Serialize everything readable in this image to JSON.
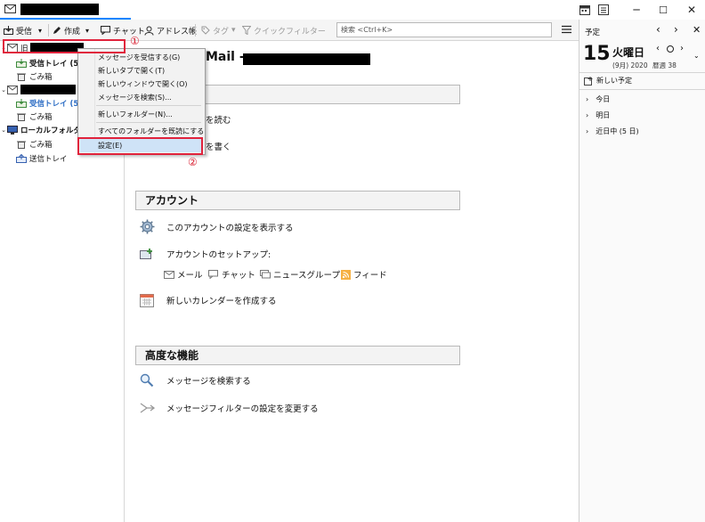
{
  "window": {
    "controls": {
      "minimize": "─",
      "maximize": "☐",
      "close": "✕"
    },
    "colors": {
      "accent": "#0a84ff",
      "highlight_red": "#e0233c",
      "selected_blue": "#2b6cc4"
    }
  },
  "toolbar": {
    "get_mail": "受信",
    "write": "作成",
    "chat": "チャット",
    "address_book": "アドレス帳",
    "tag": "タグ",
    "quick_filter": "クイックフィルター",
    "search_placeholder": "検索 <Ctrl+K>",
    "menu_icon": "hamburger-icon"
  },
  "folders": [
    {
      "label": "旧",
      "type": "account",
      "redacted": true
    },
    {
      "label": "受信トレイ (596",
      "type": "inbox"
    },
    {
      "label": "ごみ箱",
      "type": "trash"
    },
    {
      "label": "",
      "type": "account",
      "redacted": true
    },
    {
      "label": "受信トレイ (596",
      "type": "inbox",
      "selected": true
    },
    {
      "label": "ごみ箱",
      "type": "trash"
    },
    {
      "label": "ローカルフォルダー",
      "type": "local"
    },
    {
      "label": "ごみ箱",
      "type": "trash"
    },
    {
      "label": "送信トレイ",
      "type": "outbox"
    }
  ],
  "main": {
    "title": "Mail -",
    "read_messages_partial": "を読む",
    "write_message_partial": "を書く",
    "accounts_section": "アカウント",
    "view_settings": "このアカウントの設定を表示する",
    "account_setup": "アカウントのセットアップ:",
    "setup_items": [
      "メール",
      "チャット",
      "ニュースグループ",
      "フィード"
    ],
    "new_calendar": "新しいカレンダーを作成する",
    "advanced_section": "高度な機能",
    "search_messages": "メッセージを検索する",
    "message_filters": "メッセージフィルターの設定を変更する"
  },
  "context_menu": {
    "items": [
      "メッセージを受信する(G)",
      "新しいタブで開く(T)",
      "新しいウィンドウで開く(O)",
      "メッセージを検索(S)...",
      "新しいフォルダー(N)...",
      "すべてのフォルダーを既読にする",
      "設定(E)"
    ]
  },
  "annotations": {
    "step1": "①",
    "step2": "②"
  },
  "agenda": {
    "title": "予定",
    "day": "15",
    "weekday": "火曜日",
    "month_year": "(9月) 2020",
    "week": "暦週 38",
    "new_event": "新しい予定",
    "sections": [
      "今日",
      "明日",
      "近日中 (5 日)"
    ]
  }
}
